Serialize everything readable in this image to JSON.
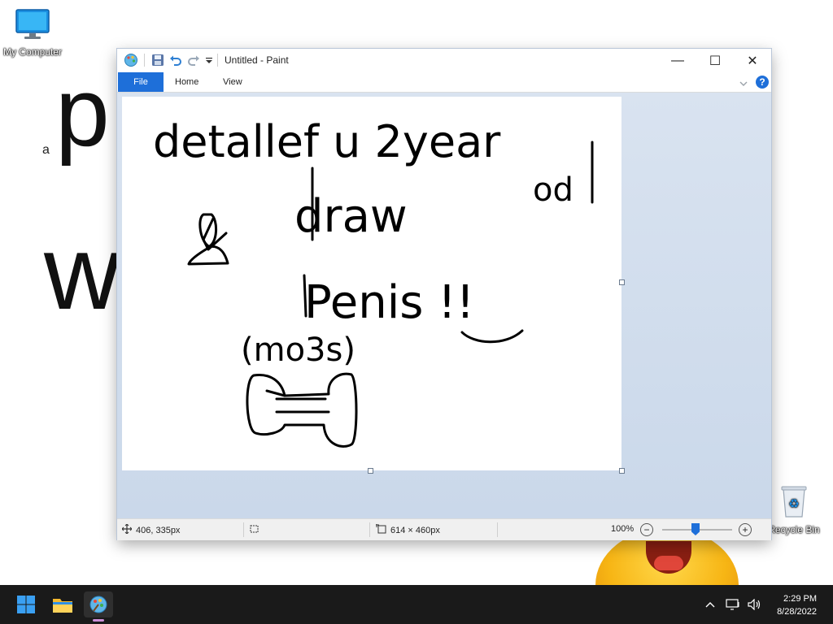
{
  "desktop": {
    "wallpaper_letters": {
      "small_a": "a",
      "big_p": "p",
      "big_w": "w"
    },
    "icons": [
      {
        "label": "My Computer",
        "icon": "monitor-icon"
      },
      {
        "label": "Recycle Bin",
        "icon": "recycle-bin-icon"
      }
    ]
  },
  "paint": {
    "title": "Untitled - Paint",
    "quick_access": [
      "paint-app-icon",
      "save-icon",
      "undo-icon",
      "redo-icon",
      "customize-dropdown-icon"
    ],
    "window_controls": {
      "minimize": "—",
      "maximize": "☐",
      "close": "✕"
    },
    "tabs": {
      "file": "File",
      "home": "Home",
      "view": "View"
    },
    "help": "?",
    "drawing_text": [
      "detallef u 2year",
      "od",
      "draw",
      "Penis !!",
      "(mo3s)"
    ],
    "status": {
      "cursor_pos": "406, 335px",
      "canvas_size": "614 × 460px",
      "zoom": "100%",
      "zoom_out": "−",
      "zoom_in": "+",
      "zoom_level": 0.5
    },
    "accent": "#1e6fd9"
  },
  "taskbar": {
    "apps": [
      "windows-start-icon",
      "file-explorer-icon",
      "paint-icon"
    ],
    "tray": {
      "chevron": "^"
    },
    "clock": {
      "time": "2:29 PM",
      "date": "8/28/2022"
    }
  }
}
